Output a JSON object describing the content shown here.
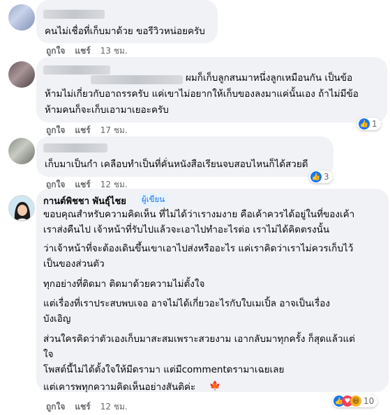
{
  "actions": {
    "like": "ถูกใจ",
    "reply": "แชร์"
  },
  "comments": [
    {
      "lines": [
        "คนไม่เชื่อที่เก็บมาด้วย ขอรีวิวหน่อยครับ"
      ],
      "time": "13 ชม."
    },
    {
      "lines": [
        "ผมก็เก็บลูกสนมาหนึ่งลูกเหมือนกัน เป็นข้อ",
        "ห้ามไม่เกี่ยวกับอาถรรครับ แค่เขาไม่อยากให้เก็บของลงมาแค่นั้นเอง ถ้าไม่มีข้อ",
        "ห้ามคนก็จะเก็บเอามาเยอะครับ"
      ],
      "time": "17 ชม.",
      "reactions": {
        "count": "1",
        "icons": [
          "like-icon"
        ]
      }
    },
    {
      "lines": [
        "เก็บมาเป็นกำ เคลือบทำเป็นที่คั่นหนังสือเรียนจบสอบไหนก็ได้สวยดี"
      ],
      "time": "12 ชม.",
      "reactions": {
        "count": "3",
        "icons": [
          "like-icon"
        ]
      }
    }
  ],
  "author_comment": {
    "name": "กานต์พิชชา พันธุ์ไชย",
    "badge": "ผู้เขียน",
    "paragraphs": [
      [
        "ขอบคุณสำหรับความคิดเห็น ที่ไม่ได้ว่าเรางมงาย คือเค้าควรได้อยู่ในที่ของเค้า",
        "เราส่งคืนไป เจ้าหน้าที่รับไปแล้วจะเอาไปทำอะไรต่อ เราไม่ได้คิดตรงนั้น"
      ],
      [
        "ว่าเจ้าหน้าที่จะต้องเดินขึ้นเขาเอาไปส่งหรืออะไร แค่เราคิดว่าเราไม่ควรเก็บไว้",
        "เป็นของส่วนตัว"
      ],
      [
        "ทุกอย่างที่ติดมา ติดมาด้วยความไม่ตั้งใจ"
      ],
      [
        "แต่เรื่องที่เราประสบพบเจอ อาจไม่ได้เกี่ยวอะไรกับใบเมเปิ้ล อาจเป็นเรื่อง",
        "บังเอิญ"
      ],
      [
        "ส่วนใครคิดว่าตัวเองเก็บมาสะสมเพราะสวยงาม เอากลับมาทุกครั้ง ก็สุดแล้วแต่",
        "ใจ"
      ],
      [
        "โพสต์นี้ไม่ได้ตั้งใจให้มีดรามา แต่มีcommentดรามาเฉยเลย"
      ],
      [
        "แต่เคารพทุกความคิดเห็นอย่างสันติค่ะ"
      ]
    ],
    "leaf_icon": "maple-leaf-icon",
    "time": "12 ชม.",
    "reactions": {
      "count": "10",
      "icons": [
        "like-icon",
        "love-icon",
        "haha-icon"
      ]
    }
  },
  "colors": {
    "bubble": "#f0f2f5",
    "meta": "#65676b",
    "link": "#1877f2"
  }
}
